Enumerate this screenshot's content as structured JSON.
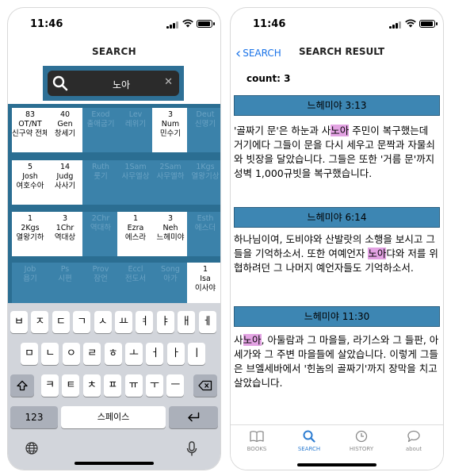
{
  "status": {
    "time": "11:46"
  },
  "left": {
    "title": "SEARCH",
    "search": {
      "query": "노아"
    },
    "books": [
      {
        "n": "83",
        "abbr": "OT/NT",
        "name": "신구약 전체",
        "active": true
      },
      {
        "n": "40",
        "abbr": "Gen",
        "name": "창세기",
        "active": true
      },
      {
        "n": "",
        "abbr": "Exod",
        "name": "출애굽기",
        "active": false
      },
      {
        "n": "",
        "abbr": "Lev",
        "name": "레위기",
        "active": false
      },
      {
        "n": "3",
        "abbr": "Num",
        "name": "민수기",
        "active": true
      },
      {
        "n": "",
        "abbr": "Deut",
        "name": "신명기",
        "active": false
      },
      {
        "n": "5",
        "abbr": "Josh",
        "name": "여호수아",
        "active": true
      },
      {
        "n": "14",
        "abbr": "Judg",
        "name": "사사기",
        "active": true
      },
      {
        "n": "",
        "abbr": "Ruth",
        "name": "룻기",
        "active": false
      },
      {
        "n": "",
        "abbr": "1Sam",
        "name": "사무엘상",
        "active": false
      },
      {
        "n": "",
        "abbr": "2Sam",
        "name": "사무엘하",
        "active": false
      },
      {
        "n": "",
        "abbr": "1Kgs",
        "name": "열왕기상",
        "active": false
      },
      {
        "n": "1",
        "abbr": "2Kgs",
        "name": "열왕기하",
        "active": true
      },
      {
        "n": "3",
        "abbr": "1Chr",
        "name": "역대상",
        "active": true
      },
      {
        "n": "",
        "abbr": "2Chr",
        "name": "역대하",
        "active": false
      },
      {
        "n": "1",
        "abbr": "Ezra",
        "name": "에스라",
        "active": true
      },
      {
        "n": "3",
        "abbr": "Neh",
        "name": "느헤미야",
        "active": true
      },
      {
        "n": "",
        "abbr": "Esth",
        "name": "에스더",
        "active": false
      },
      {
        "n": "",
        "abbr": "Job",
        "name": "욥기",
        "active": false
      },
      {
        "n": "",
        "abbr": "Ps",
        "name": "시편",
        "active": false
      },
      {
        "n": "",
        "abbr": "Prov",
        "name": "잠언",
        "active": false
      },
      {
        "n": "",
        "abbr": "Eccl",
        "name": "전도서",
        "active": false
      },
      {
        "n": "",
        "abbr": "Song",
        "name": "아가",
        "active": false
      },
      {
        "n": "1",
        "abbr": "Isa",
        "name": "이사야",
        "active": true
      }
    ],
    "keyboard": {
      "row1": [
        "ㅂ",
        "ㅈ",
        "ㄷ",
        "ㄱ",
        "ㅅ",
        "ㅛ",
        "ㅕ",
        "ㅑ",
        "ㅐ",
        "ㅔ"
      ],
      "row2": [
        "ㅁ",
        "ㄴ",
        "ㅇ",
        "ㄹ",
        "ㅎ",
        "ㅗ",
        "ㅓ",
        "ㅏ",
        "ㅣ"
      ],
      "row3": [
        "ㅋ",
        "ㅌ",
        "ㅊ",
        "ㅍ",
        "ㅠ",
        "ㅜ",
        "ㅡ"
      ],
      "num": "123",
      "space": "스페이스",
      "shift_icon": "shift-icon",
      "backspace_icon": "backspace-icon",
      "return_icon": "return-icon"
    }
  },
  "right": {
    "back_label": "SEARCH",
    "title": "SEARCH RESULT",
    "count": "count: 3",
    "results": [
      {
        "ref": "느헤미야 3:13",
        "pre": "'골짜기 문'은 하눈과 사",
        "hl": "노아",
        "post": " 주민이 복구했는데 거기에다 그들이 문을 다시 세우고 문짝과 자물쇠와 빗장을 달았습니다. 그들은 또한 '거름 문'까지 성벽 1,000규빗을 복구했습니다."
      },
      {
        "ref": "느헤미야 6:14",
        "pre": "하나님이여, 도비야와 산발랏의 소행을 보시고 그들을 기억하소서. 또한 여예언자 ",
        "hl": "노아",
        "post": "댜와 저를 위협하려던 그 나머지 예언자들도 기억하소서."
      },
      {
        "ref": "느헤미야 11:30",
        "pre": "사",
        "hl": "노아",
        "post": ", 아둘람과 그 마을들, 라기스와 그 들판, 아세가와 그 주변 마을들에 살았습니다. 이렇게 그들은 브엘세바에서 '힌놈의 골짜기'까지 장막을 치고 살았습니다."
      }
    ],
    "tabs": [
      {
        "label": "BOOKS",
        "icon": "book-icon"
      },
      {
        "label": "SEARCH",
        "icon": "search-icon"
      },
      {
        "label": "HISTORY",
        "icon": "clock-icon"
      },
      {
        "label": "about",
        "icon": "chat-bubble-icon"
      }
    ],
    "active_tab": "SEARCH",
    "colors": {
      "accent": "#2e7dd1",
      "grid_bg": "#2b6e92",
      "section": "#3d86b3",
      "highlight": "#e3a3e3"
    }
  }
}
